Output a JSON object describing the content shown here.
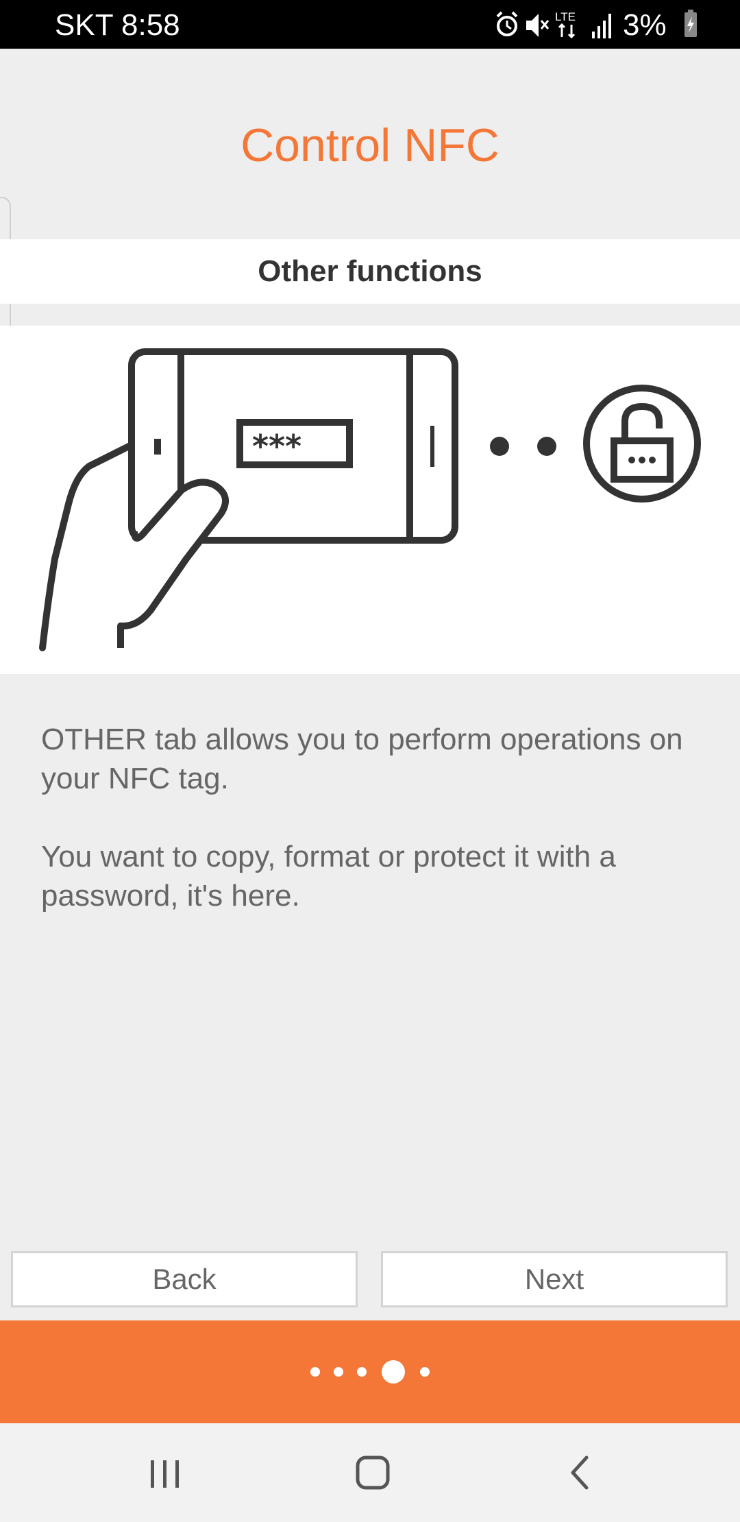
{
  "status_bar": {
    "carrier_time": "SKT 8:58",
    "battery": "3%",
    "icons": [
      "alarm-icon",
      "mute-icon",
      "lte-icon",
      "signal-icon",
      "battery-icon"
    ]
  },
  "page": {
    "title": "Control NFC",
    "section": "Other functions",
    "description": [
      "OTHER tab allows you to perform operations on your NFC tag.",
      "You want to copy, format or protect it with a password, it's here."
    ]
  },
  "illustration": {
    "password_mask": "***",
    "icons": [
      "hand-holding-phone-icon",
      "password-field-icon",
      "connection-dots-icon",
      "padlock-icon"
    ]
  },
  "buttons": {
    "back": "Back",
    "next": "Next"
  },
  "pager": {
    "total": 5,
    "current": 4
  },
  "nav": {
    "icons": [
      "recent-apps-icon",
      "home-icon",
      "back-icon"
    ]
  },
  "colors": {
    "accent": "#f47738",
    "background": "#eeeeee",
    "text": "#666666"
  }
}
